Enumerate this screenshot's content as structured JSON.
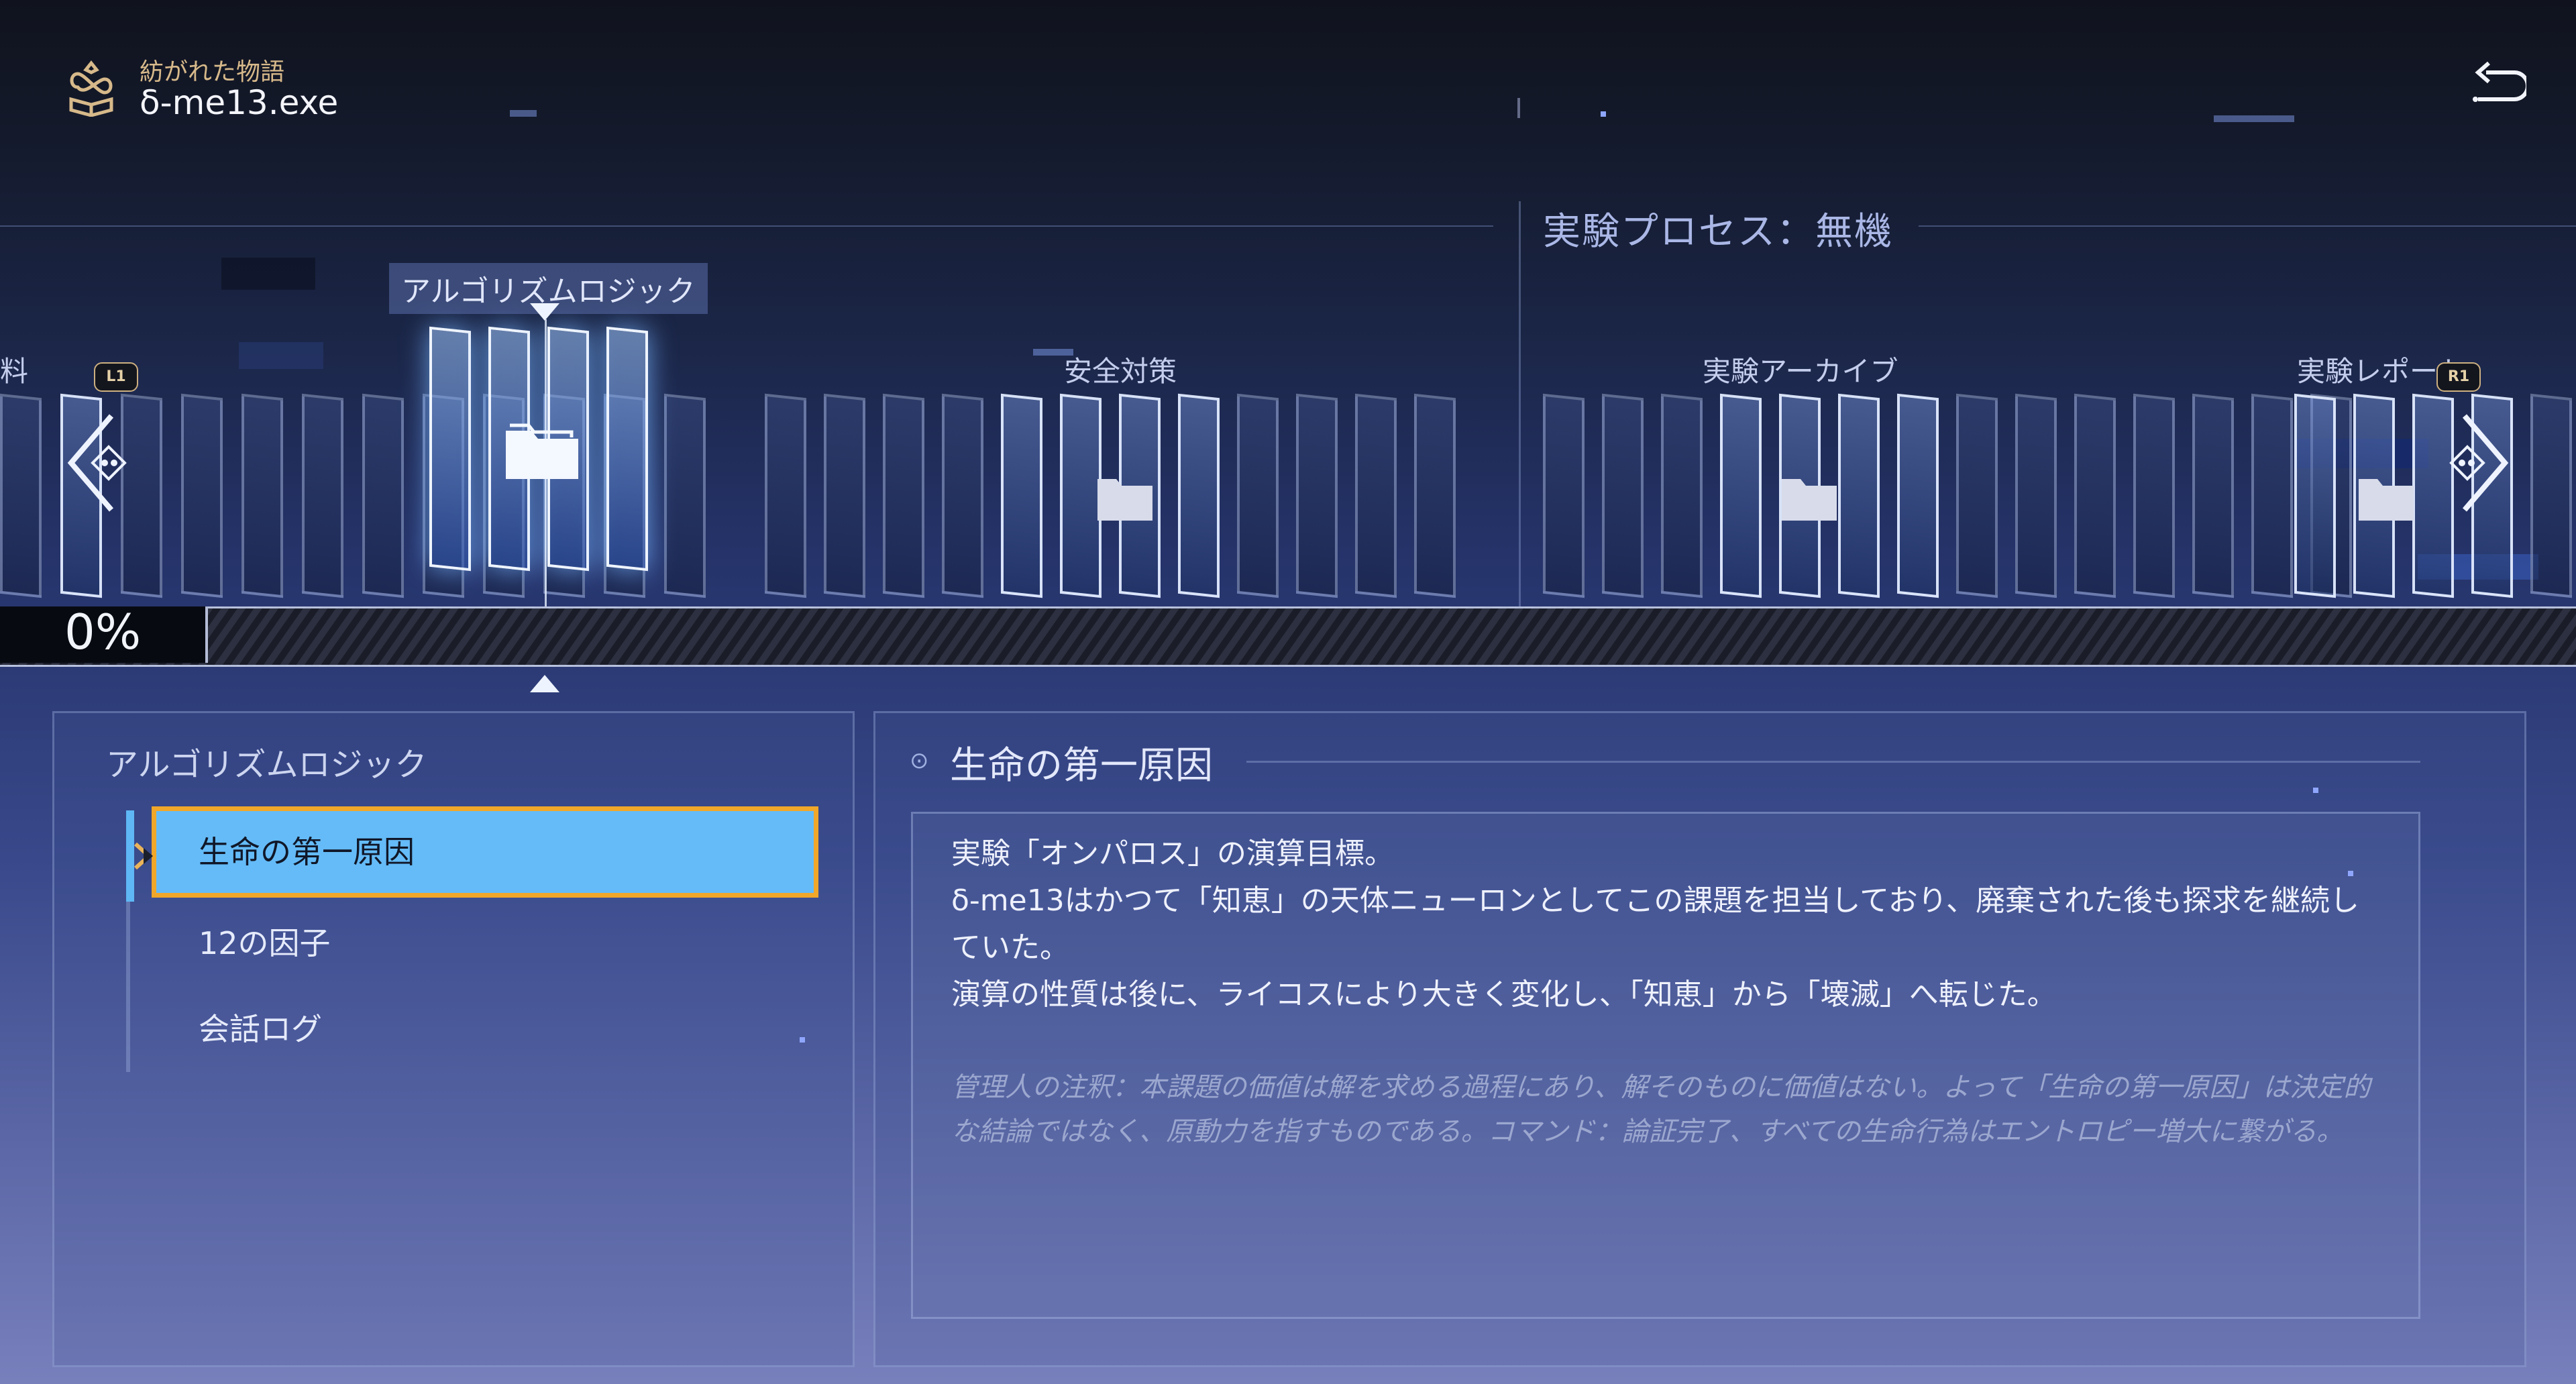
{
  "header": {
    "subtitle": "紡がれた物語",
    "title": "δ-me13.exe"
  },
  "stage": {
    "title": "実験プロセス：無機"
  },
  "track": {
    "selected_label": "アルゴリズムロジック",
    "groups": [
      {
        "label": "料"
      },
      {
        "label": "安全対策"
      },
      {
        "label": "実験アーカイブ"
      },
      {
        "label": "実験レポート"
      }
    ],
    "left_badge": "L1",
    "right_badge": "R1"
  },
  "progress": {
    "value_text": "0%",
    "value": 0
  },
  "list": {
    "category": "アルゴリズムロジック",
    "items": [
      {
        "label": "生命の第一原因"
      },
      {
        "label": "12の因子"
      },
      {
        "label": "会話ログ"
      }
    ],
    "selected_index": 0
  },
  "entry": {
    "title": "生命の第一原因",
    "paragraphs": [
      "実験「オンパロス」の演算目標。",
      "δ-me13はかつて「知恵」の天体ニューロンとしてこの課題を担当しており、廃棄された後も探求を継続していた。",
      "演算の性質は後に、ライコスにより大きく変化し、「知恵」から「壊滅」へ転じた。"
    ],
    "note": "管理人の注釈：本課題の価値は解を求める過程にあり、解そのものに価値はない。よって「生命の第一原因」は決定的な結論ではなく、原動力を指すものである。コマンド：論証完了、すべての生命行為はエントロピー増大に繋がる。"
  },
  "colors": {
    "selected_fill": "#64bbf7",
    "selected_border": "#f1a72a",
    "emblem_gold": "#d7b98a"
  },
  "icons": [
    "story-emblem-icon",
    "back-arrow-icon",
    "chevron-left-icon",
    "chevron-right-icon",
    "folder-icon",
    "selection-marker-icon"
  ]
}
